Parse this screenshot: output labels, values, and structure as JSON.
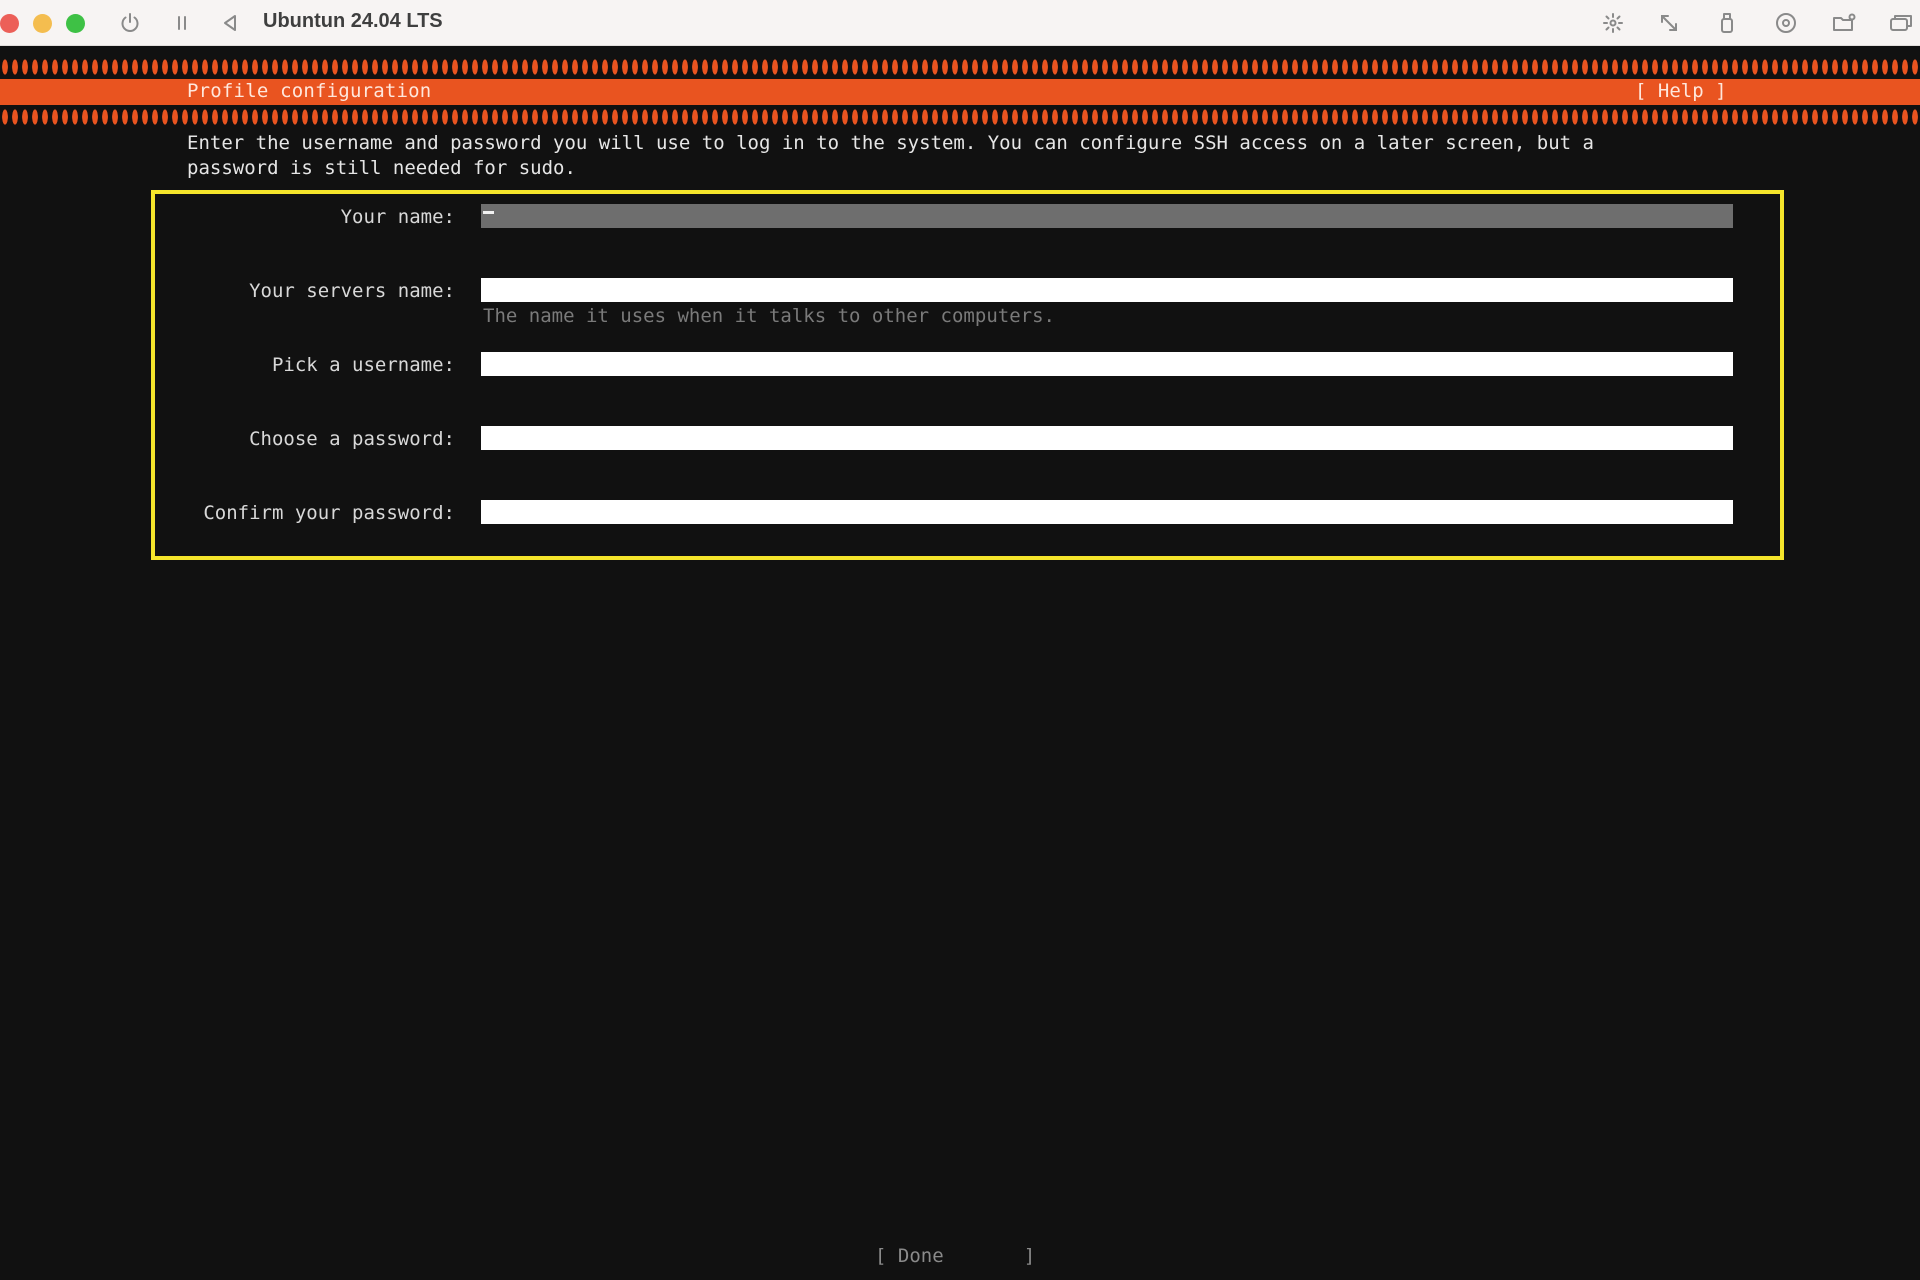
{
  "window": {
    "title": "Ubuntun 24.04 LTS",
    "traffic_lights": {
      "close_color": "#ec5f58",
      "minimize_color": "#f4bd4f",
      "maximize_color": "#3ec145"
    },
    "left_controls": [
      "power-icon",
      "pause-icon",
      "back-icon"
    ],
    "right_controls": [
      "brightness-icon",
      "resize-icon",
      "usb-icon",
      "disc-icon",
      "folder-icon",
      "display-icon"
    ]
  },
  "installer": {
    "header_title": "Profile configuration",
    "help_label": "[ Help ]",
    "intro": "Enter the username and password you will use to log in to the system. You can configure SSH access on a later screen, but a\npassword is still needed for sudo.",
    "accent_color": "#e95420",
    "highlight_color": "#f5e52b",
    "fields": [
      {
        "label": "Your name:",
        "value": "",
        "active": true
      },
      {
        "label": "Your servers name:",
        "value": "",
        "hint": "The name it uses when it talks to other computers."
      },
      {
        "label": "Pick a username:",
        "value": ""
      },
      {
        "label": "Choose a password:",
        "value": ""
      },
      {
        "label": "Confirm your password:",
        "value": ""
      }
    ],
    "done_label": "[ Done       ]"
  }
}
